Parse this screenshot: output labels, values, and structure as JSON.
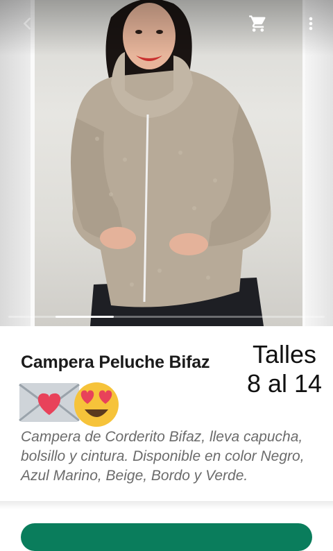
{
  "product": {
    "title": "Campera Peluche Bifaz",
    "sizes_line1": "Talles",
    "sizes_line2": "8 al 14",
    "description": "Campera de Corderito Bifaz, lleva capucha, bolsillo y cintura. Disponible en color Negro, Azul Marino, Beige, Bordo y Verde.",
    "emoji": [
      "love-letter-emoji",
      "heart-eyes-emoji"
    ]
  },
  "gallery": {
    "image_count_hint": "carousel",
    "active_index": 1
  },
  "toolbar": {
    "icons": [
      "back-arrow-icon",
      "cart-icon",
      "more-vert-icon"
    ]
  },
  "colors": {
    "accent": "#0a7d5c",
    "jacket": "#b7aa98"
  }
}
